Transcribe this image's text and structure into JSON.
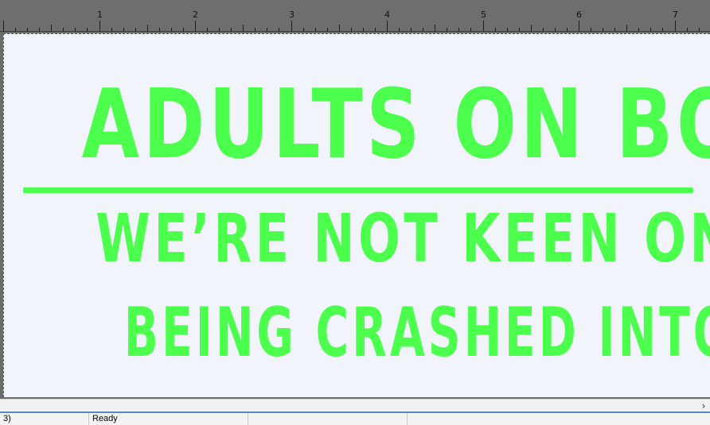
{
  "ruler": {
    "labels": [
      "1",
      "2",
      "3",
      "4",
      "5",
      "6",
      "7"
    ]
  },
  "sign": {
    "line1": "ADULTS ON BOARD",
    "line2": "WE’RE NOT KEEN ON",
    "line3": "BEING CRASHED INTO EITHER",
    "color": "#4cff4c"
  },
  "scrollbar": {
    "right_arrow": "›"
  },
  "status": {
    "cell1": "3)",
    "cell2": "Ready"
  }
}
